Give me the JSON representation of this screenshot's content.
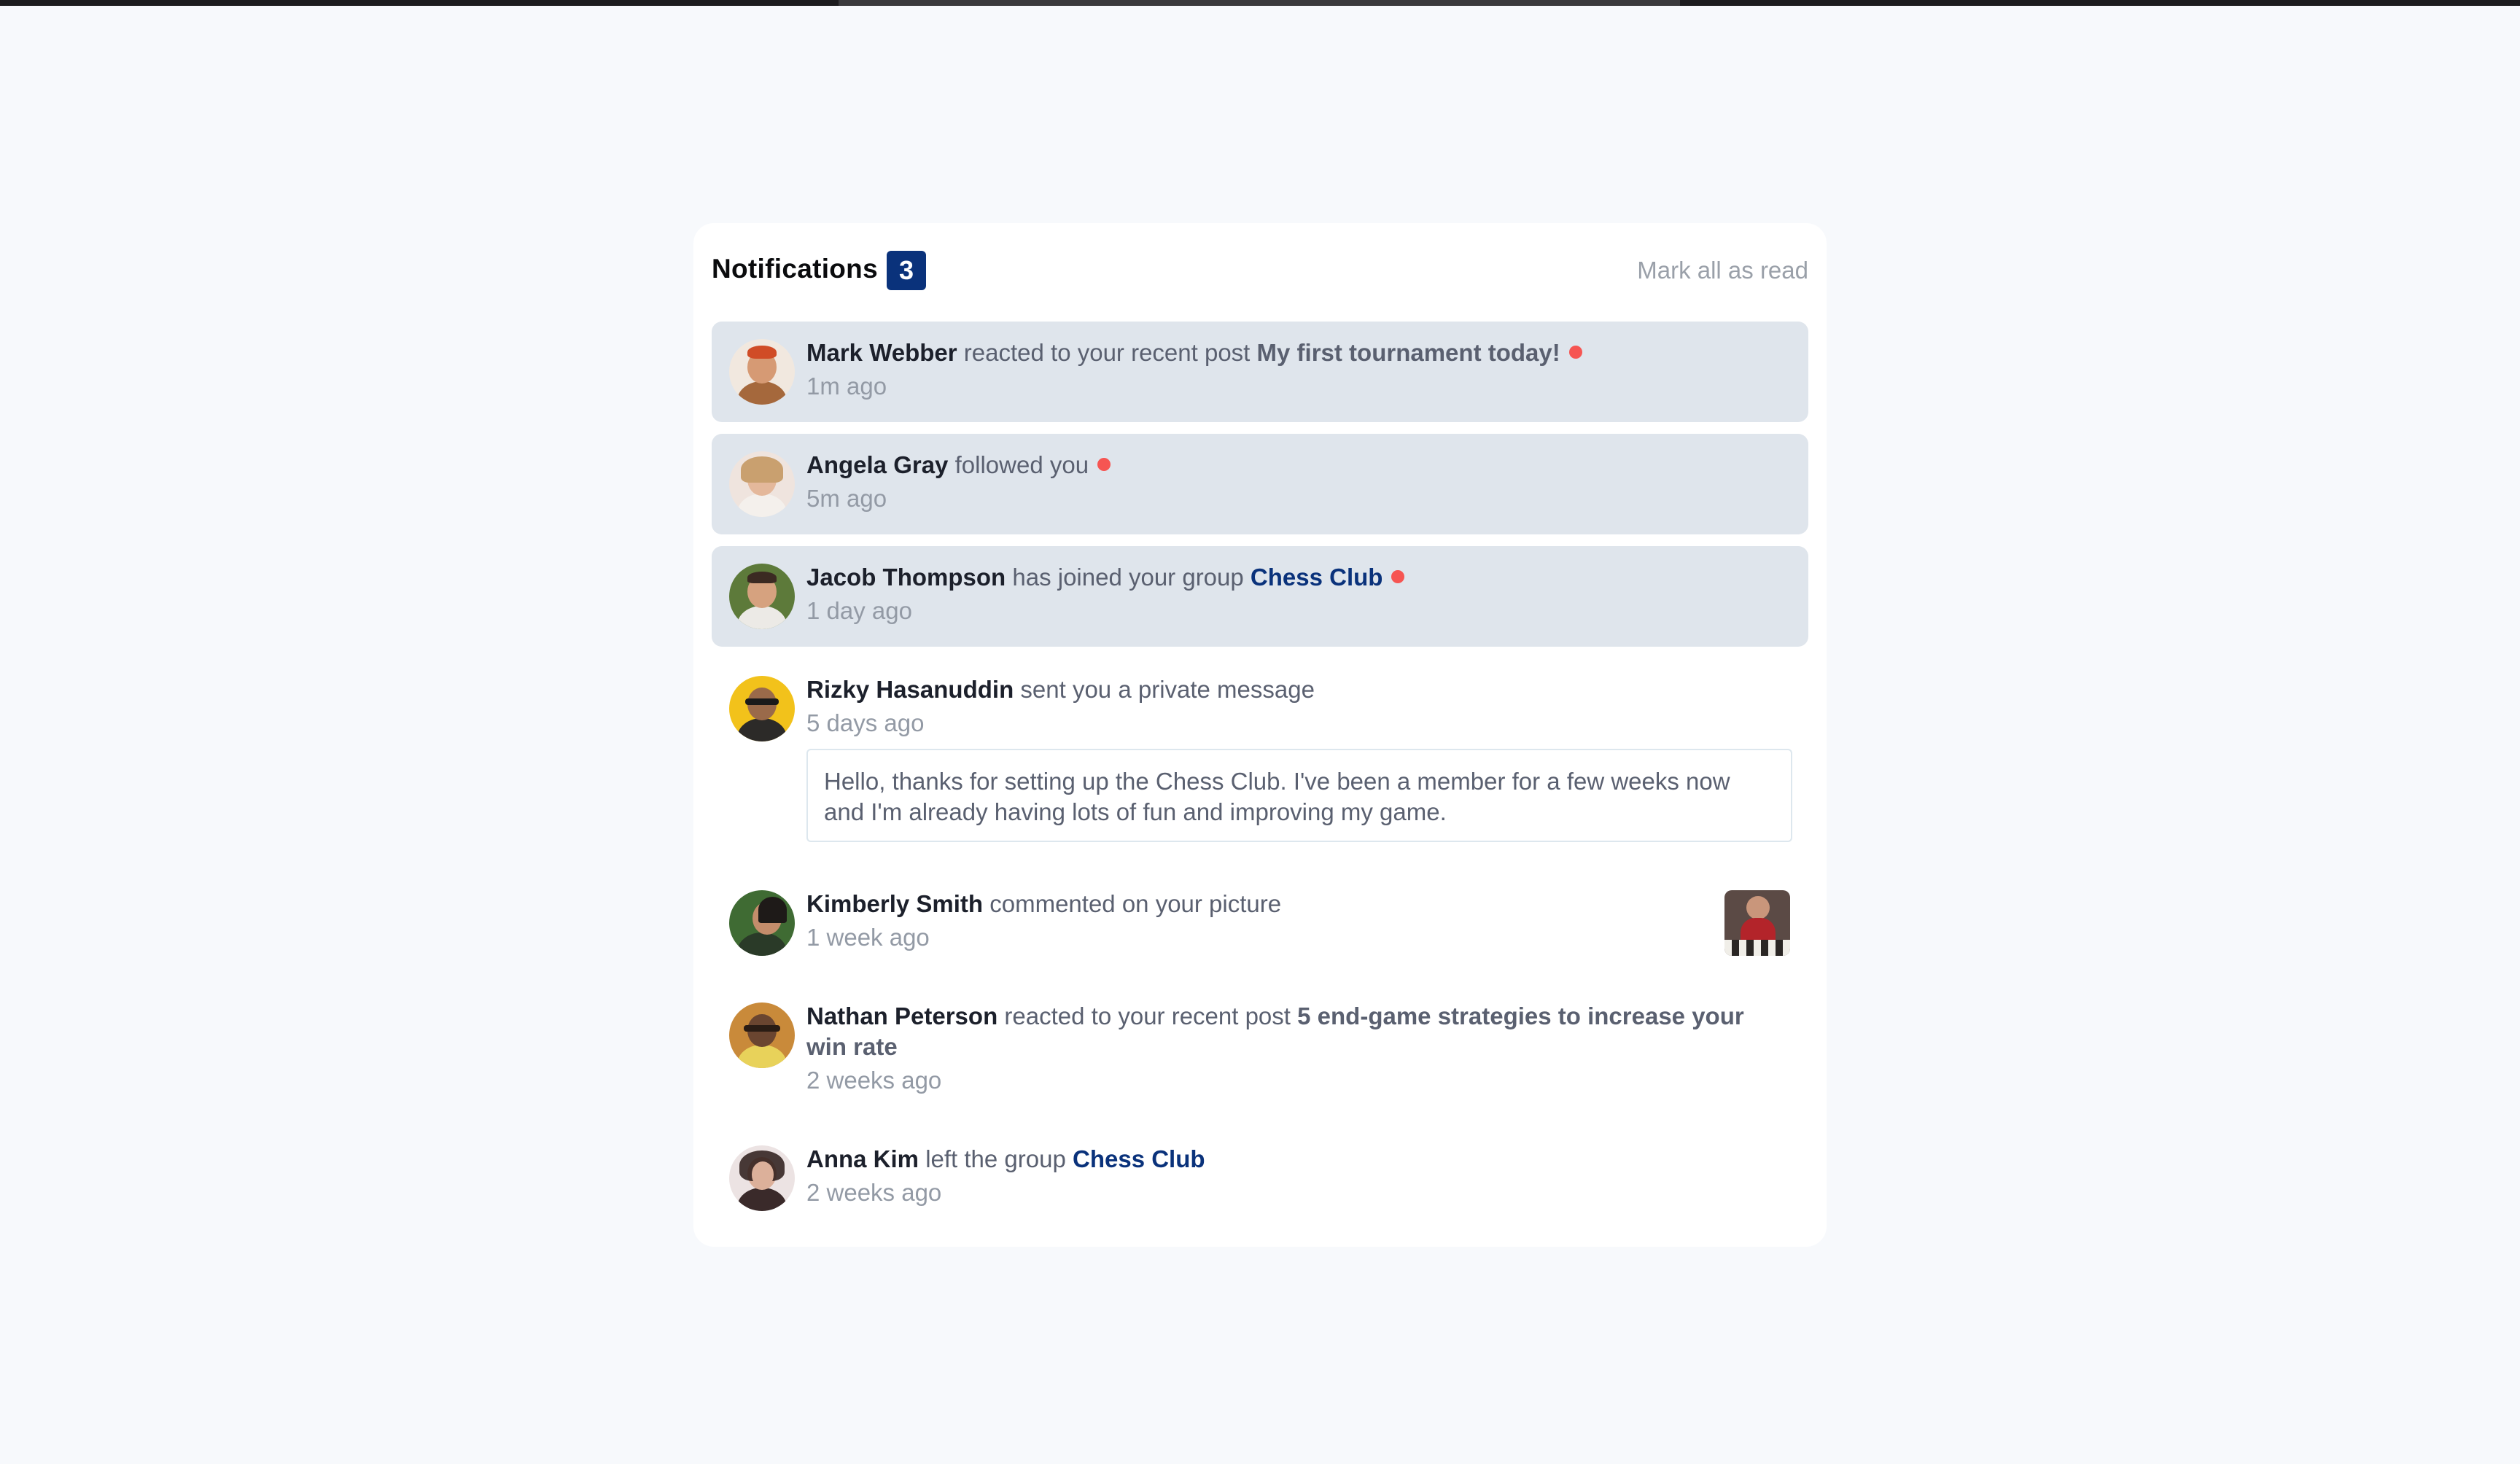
{
  "header": {
    "title": "Notifications",
    "unread_count": "3",
    "mark_all_label": "Mark all as read"
  },
  "colors": {
    "accent": "#0a327b",
    "unread_bg": "#dfe5ec",
    "dot": "#f65552",
    "page_bg": "#f7f9fc"
  },
  "notifications": [
    {
      "name": "Mark Webber",
      "action": "reacted to your recent post",
      "target": "My first tournament today!",
      "time": "1m ago",
      "unread": true
    },
    {
      "name": "Angela Gray",
      "action": "followed you",
      "time": "5m ago",
      "unread": true
    },
    {
      "name": "Jacob Thompson",
      "action": "has joined your group",
      "group": "Chess Club",
      "time": "1 day ago",
      "unread": true
    },
    {
      "name": "Rizky Hasanuddin",
      "action": "sent you a private message",
      "time": "5 days ago",
      "message": "Hello, thanks for setting up the Chess Club. I've been a member for a few weeks now and I'm already having lots of fun and improving my game.",
      "unread": false
    },
    {
      "name": "Kimberly Smith",
      "action": "commented on your picture",
      "time": "1 week ago",
      "unread": false
    },
    {
      "name": "Nathan Peterson",
      "action": "reacted to your recent post",
      "target": "5 end-game strategies to increase your win rate",
      "time": "2 weeks ago",
      "unread": false
    },
    {
      "name": "Anna Kim",
      "action": "left the group",
      "group": "Chess Club",
      "time": "2 weeks ago",
      "unread": false
    }
  ]
}
